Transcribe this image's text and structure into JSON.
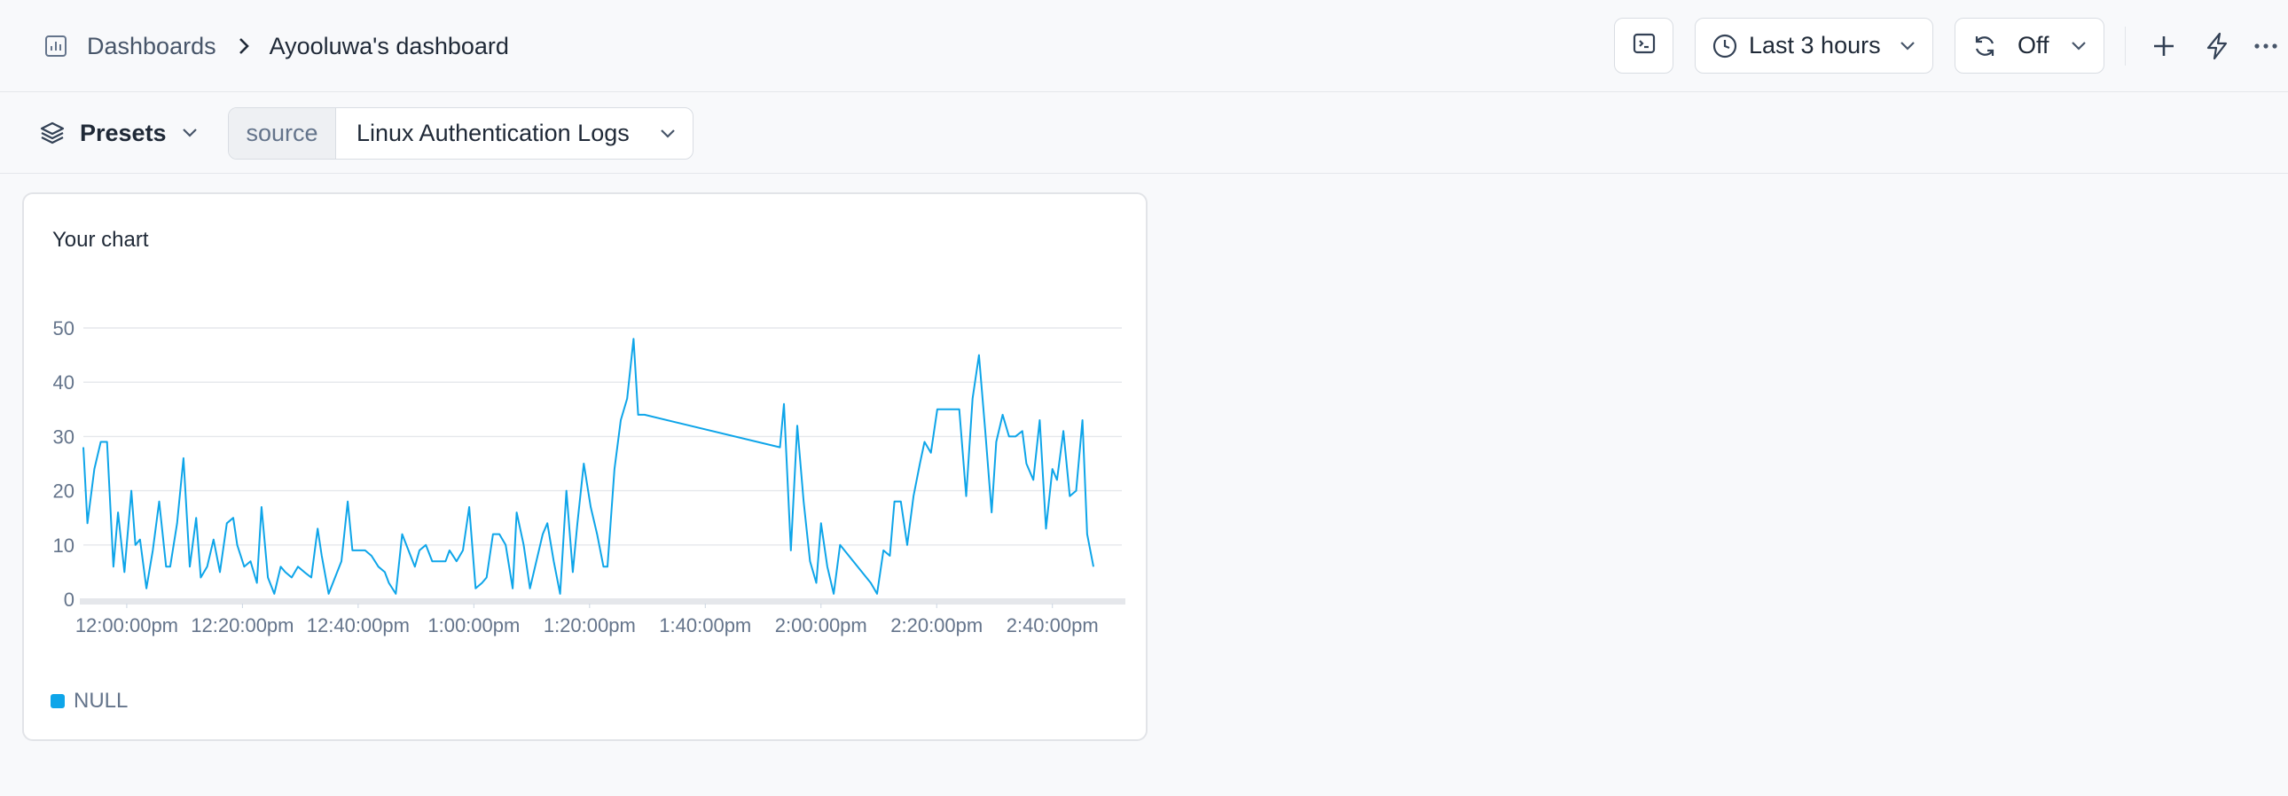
{
  "breadcrumb": {
    "root": "Dashboards",
    "current": "Ayooluwa's dashboard"
  },
  "toolbar": {
    "time_range": "Last 3 hours",
    "refresh": "Off"
  },
  "icons": {
    "dashboard": "bar-chart-icon",
    "separator": "chevron-right-icon",
    "terminal": "terminal-icon",
    "clock": "clock-icon",
    "refresh": "refresh-icon",
    "add": "plus-icon",
    "lightning": "bolt-icon",
    "more": "more-horizontal-icon"
  },
  "filters": {
    "presets_label": "Presets",
    "source_key": "source",
    "source_value": "Linux Authentication Logs"
  },
  "colors": {
    "series": "#0ea5e9",
    "grid": "#e5e7eb",
    "tick": "#64748b"
  },
  "panel": {
    "title": "Your chart"
  },
  "chart_data": {
    "type": "line",
    "title": "Your chart",
    "x_ticks": [
      "12:00:00pm",
      "12:20:00pm",
      "12:40:00pm",
      "1:00:00pm",
      "1:20:00pm",
      "1:40:00pm",
      "2:00:00pm",
      "2:20:00pm",
      "2:40:00pm"
    ],
    "y_ticks": [
      "0",
      "10",
      "20",
      "30",
      "40",
      "50"
    ],
    "ylim": [
      0,
      50
    ],
    "xlim_minutes": [
      -7.5,
      172
    ],
    "grid": true,
    "legend_position": "bottom-left",
    "series": [
      {
        "name": "NULL",
        "color": "#0ea5e9",
        "x_minutes": [
          -7.5,
          -6.8,
          -5.6,
          -4.5,
          -3.4,
          -2.3,
          -1.5,
          -0.4,
          0.8,
          1.5,
          2.3,
          3.4,
          4.5,
          5.6,
          6.8,
          7.5,
          8.7,
          9.8,
          10.9,
          12,
          12.8,
          13.9,
          15,
          16.1,
          17.3,
          18.4,
          19.1,
          20.3,
          21.4,
          22.5,
          23.3,
          24.4,
          25.5,
          26.6,
          27.4,
          28.5,
          29.6,
          30.7,
          31.9,
          33,
          33.7,
          34.9,
          36,
          37.1,
          38.2,
          39,
          40.1,
          41.2,
          42.3,
          43.5,
          44.6,
          45.3,
          46.5,
          47.6,
          48.7,
          49.8,
          50.6,
          51.7,
          52.8,
          53.9,
          55.1,
          55.8,
          57,
          58.1,
          59.2,
          60.3,
          61.4,
          62.2,
          63.3,
          64.4,
          65.5,
          66.7,
          67.4,
          68.6,
          69.7,
          70.8,
          71.9,
          72.7,
          73.8,
          74.9,
          76,
          77.1,
          77.9,
          79,
          80.2,
          81.3,
          82.4,
          83.1,
          84.3,
          85.4,
          86.5,
          87.6,
          88.4,
          89.5,
          112.9,
          113.6,
          114.8,
          115.9,
          117,
          118.1,
          119.2,
          120,
          121.1,
          122.2,
          123.3,
          128.6,
          129.7,
          130.8,
          131.9,
          132.7,
          133.8,
          134.9,
          136,
          137.1,
          137.9,
          139,
          140.1,
          143.9,
          145.1,
          146.2,
          147.3,
          148.4,
          149.5,
          150.3,
          151.4,
          152.5,
          153.6,
          154.8,
          155.5,
          156.7,
          157.8,
          158.9,
          160,
          160.8,
          161.9,
          163,
          164.1,
          165.2,
          166,
          167.1,
          168.3,
          169.4,
          170.5,
          171.3
        ],
        "y": [
          28,
          14,
          24,
          29,
          29,
          6,
          16,
          5,
          20,
          10,
          11,
          2,
          9,
          18,
          6,
          6,
          14,
          26,
          6,
          15,
          4,
          6,
          11,
          5,
          14,
          15,
          10,
          6,
          7,
          3,
          17,
          4,
          1,
          6,
          5,
          4,
          6,
          5,
          4,
          13,
          8,
          1,
          4,
          7,
          18,
          9,
          9,
          9,
          8,
          6,
          5,
          3,
          1,
          12,
          9,
          6,
          9,
          10,
          7,
          7,
          7,
          9,
          7,
          9,
          17,
          2,
          3,
          4,
          12,
          12,
          10,
          2,
          16,
          10,
          2,
          7,
          12,
          14,
          7,
          1,
          20,
          5,
          14,
          25,
          17,
          12,
          6,
          6,
          24,
          33,
          37,
          48,
          34,
          34,
          28,
          36,
          9,
          32,
          18,
          7,
          3,
          14,
          6,
          1,
          10,
          3,
          1,
          9,
          8,
          18,
          18,
          10,
          19,
          25,
          29,
          27,
          35,
          35,
          19,
          37,
          45,
          31,
          16,
          29,
          34,
          30,
          30,
          31,
          25,
          22,
          33,
          13,
          24,
          22,
          31,
          19,
          20,
          33,
          12,
          6
        ]
      }
    ]
  }
}
